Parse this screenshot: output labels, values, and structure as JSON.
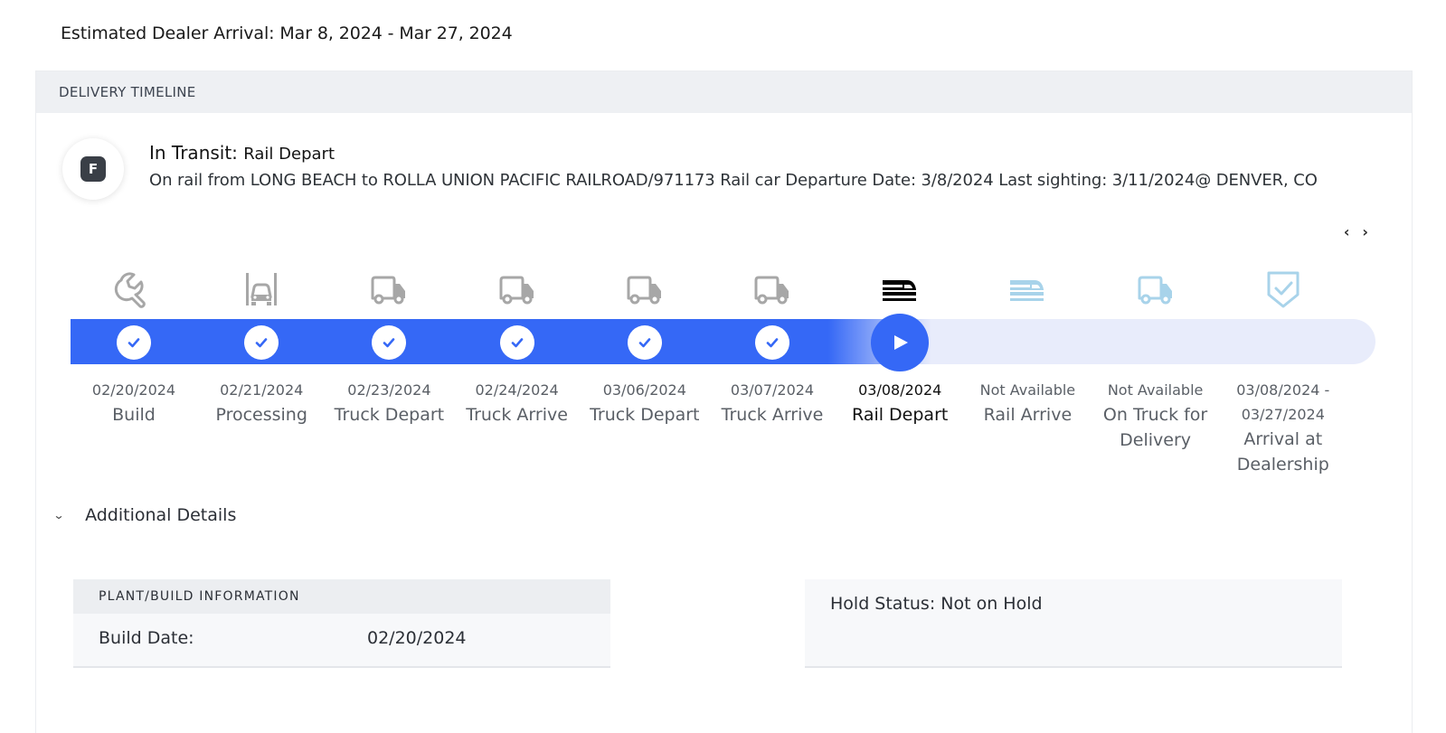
{
  "arrival": {
    "text": "Estimated Dealer Arrival: Mar 8, 2024 - Mar 27, 2024"
  },
  "timeline": {
    "header": "DELIVERY TIMELINE",
    "badge_letter": "F",
    "status_label": "In Transit:",
    "status_sub": "Rail Depart",
    "status_desc": "On rail from LONG BEACH to ROLLA UNION PACIFIC RAILROAD/971173 Rail car Departure Date: 3/8/2024 Last sighting: 3/11/2024@ DENVER, CO",
    "nav_prev": "‹",
    "nav_next": "›",
    "progress_fraction": 0.66,
    "colors": {
      "accent": "#3568f6",
      "done_icon": "#a7a7a7",
      "future_icon": "#a8d3ea",
      "current_icon": "#000000",
      "track_bg": "#e8ecfb"
    },
    "stages": [
      {
        "date": "02/20/2024",
        "name": "Build",
        "icon": "wrench-icon",
        "state": "done"
      },
      {
        "date": "02/21/2024",
        "name": "Processing",
        "icon": "factory-vehicle-icon",
        "state": "done"
      },
      {
        "date": "02/23/2024",
        "name": "Truck Depart",
        "icon": "truck-icon",
        "state": "done"
      },
      {
        "date": "02/24/2024",
        "name": "Truck Arrive",
        "icon": "truck-icon",
        "state": "done"
      },
      {
        "date": "03/06/2024",
        "name": "Truck Depart",
        "icon": "truck-icon",
        "state": "done"
      },
      {
        "date": "03/07/2024",
        "name": "Truck Arrive",
        "icon": "truck-icon",
        "state": "done"
      },
      {
        "date": "03/08/2024",
        "name": "Rail Depart",
        "icon": "train-icon",
        "state": "current"
      },
      {
        "date": "Not Available",
        "name": "Rail Arrive",
        "icon": "train-icon",
        "state": "future"
      },
      {
        "date": "Not Available",
        "name": "On Truck for Delivery",
        "icon": "truck-icon",
        "state": "future"
      },
      {
        "date": "03/08/2024 - 03/27/2024",
        "name": "Arrival at Dealership",
        "icon": "shield-check-icon",
        "state": "future"
      }
    ]
  },
  "details": {
    "toggle_label": "Additional Details",
    "plant": {
      "header": "PLANT/BUILD INFORMATION",
      "build_label": "Build Date:",
      "build_value": "02/20/2024"
    },
    "hold": {
      "text": "Hold Status: Not on Hold"
    }
  }
}
